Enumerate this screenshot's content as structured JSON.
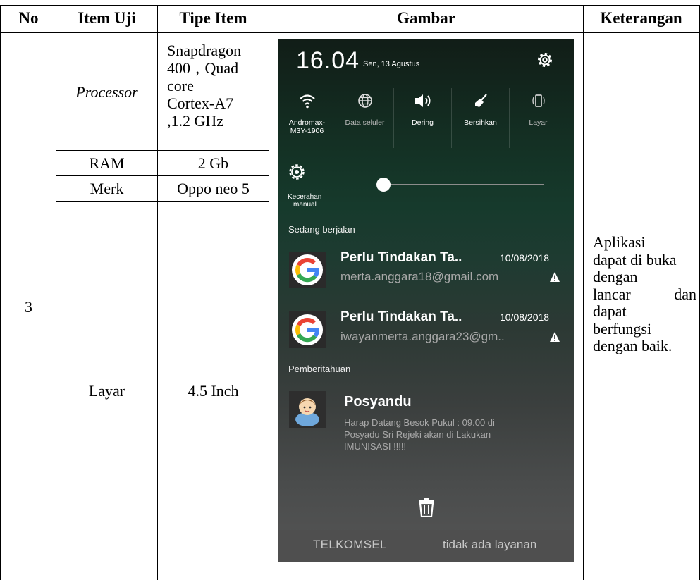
{
  "table": {
    "headers": {
      "no": "No",
      "item": "Item Uji",
      "type": "Tipe Item",
      "image": "Gambar",
      "note": "Keterangan"
    },
    "number": "3",
    "rows": [
      {
        "item": "Processor",
        "type": [
          "Snapdragon",
          "400 , Quad",
          "core",
          "Cortex-A7",
          ",1.2 GHz"
        ]
      },
      {
        "item": "RAM",
        "type": "2 Gb"
      },
      {
        "item": "Merk",
        "type": "Oppo neo 5"
      },
      {
        "item": "Layar",
        "type": "4.5 Inch"
      }
    ],
    "note_lines": [
      "Aplikasi",
      "dapat di buka",
      "dengan",
      "lancar",
      "dan",
      "dapat",
      "berfungsi",
      "dengan baik."
    ]
  },
  "phone": {
    "clock": "16.04",
    "date": "Sen, 13 Agustus",
    "settings_icon": "gear-icon",
    "quick_tiles": [
      {
        "icon": "wifi-icon",
        "label_line1": "Andromax-",
        "label_line2": "M3Y-1906"
      },
      {
        "icon": "globe-icon",
        "label_line1": "Data seluler",
        "label_line2": ""
      },
      {
        "icon": "speaker-icon",
        "label_line1": "Dering",
        "label_line2": ""
      },
      {
        "icon": "broom-icon",
        "label_line1": "Bersihkan",
        "label_line2": ""
      },
      {
        "icon": "screen-rotate-icon",
        "label_line1": "Layar",
        "label_line2": ""
      }
    ],
    "brightness": {
      "label_line1": "Kecerahan",
      "label_line2": "manual",
      "level": 0.0
    },
    "section_running": "Sedang berjalan",
    "notifications": [
      {
        "app_icon": "google-icon",
        "title": "Perlu Tindakan Ta..",
        "time": "10/08/2018",
        "text": "merta.anggara18@gmail.com",
        "alert_icon": "warning-icon"
      },
      {
        "app_icon": "google-icon",
        "title": "Perlu Tindakan Ta..",
        "time": "10/08/2018",
        "text": "iwayanmerta.anggara23@gm..",
        "alert_icon": "warning-icon"
      }
    ],
    "section_notifications": "Pemberitahuan",
    "app_notification": {
      "app_icon": "baby-icon",
      "title": "Posyandu",
      "body_line1": "Harap Datang Besok Pukul : 09.00 di",
      "body_line2": "Posyadu Sri Rejeki akan di Lakukan",
      "body_line3": "IMUNISASI !!!!!"
    },
    "clear_icon": "trash-icon",
    "carrier": "TELKOMSEL",
    "service_status": "tidak ada layanan"
  }
}
